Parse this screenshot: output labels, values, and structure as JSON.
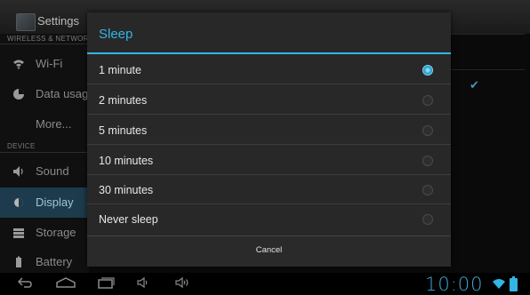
{
  "background": {
    "app_title": "Settings",
    "sections": [
      {
        "header": "WIRELESS & NETWORKS",
        "items": [
          {
            "label": "Wi-Fi",
            "icon": "wifi-icon"
          },
          {
            "label": "Data usage",
            "icon": "data-usage-icon"
          },
          {
            "label": "More...",
            "icon": ""
          }
        ]
      },
      {
        "header": "DEVICE",
        "items": [
          {
            "label": "Sound",
            "icon": "sound-icon"
          },
          {
            "label": "Display",
            "icon": "display-icon",
            "selected": true
          },
          {
            "label": "Storage",
            "icon": "storage-icon"
          },
          {
            "label": "Battery",
            "icon": "battery-icon"
          }
        ]
      }
    ]
  },
  "dialog": {
    "title": "Sleep",
    "options": [
      {
        "label": "1 minute",
        "selected": true
      },
      {
        "label": "2 minutes",
        "selected": false
      },
      {
        "label": "5 minutes",
        "selected": false
      },
      {
        "label": "10 minutes",
        "selected": false
      },
      {
        "label": "30 minutes",
        "selected": false
      },
      {
        "label": "Never sleep",
        "selected": false
      }
    ],
    "cancel_label": "Cancel"
  },
  "system_bar": {
    "clock": "10:00",
    "nav_icons": [
      "back-icon",
      "home-icon",
      "recent-apps-icon",
      "volume-down-icon",
      "volume-up-icon"
    ]
  },
  "colors": {
    "accent": "#33b5e5",
    "dialog_bg": "#282828",
    "selected_item_bg": "#1d3b4c"
  }
}
